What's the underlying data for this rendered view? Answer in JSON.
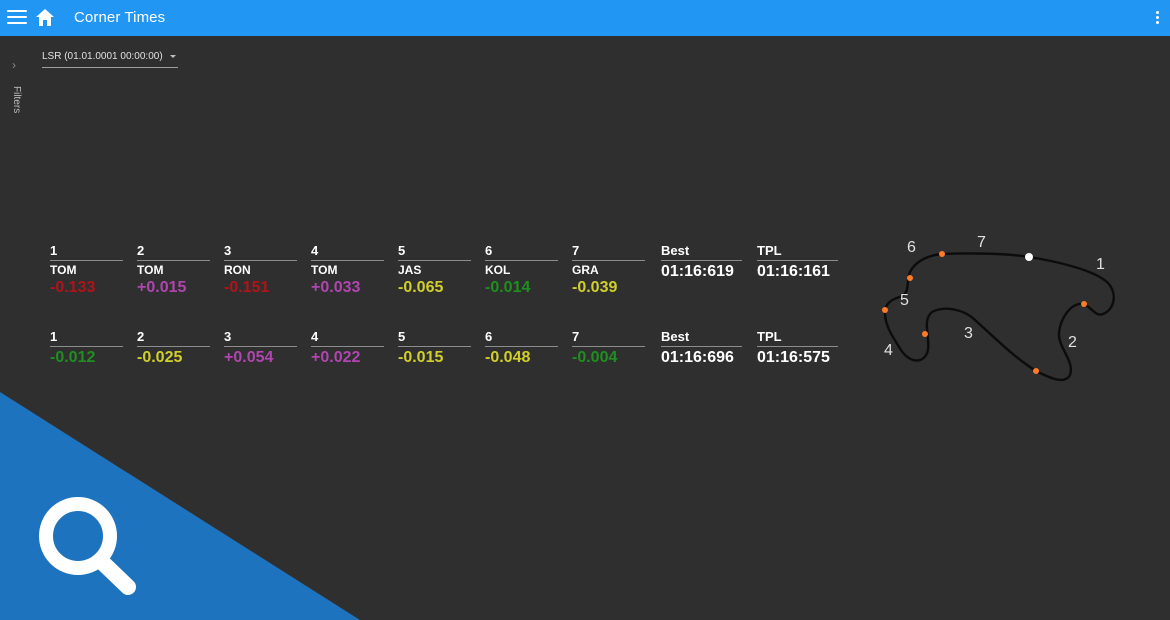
{
  "app": {
    "title": "Corner Times"
  },
  "filters": {
    "label": "Filters",
    "chevron": "›"
  },
  "session": {
    "selected": "LSR (01.01.0001 00:00:00)"
  },
  "colors": {
    "appbar": "#2196f3",
    "background": "#2f2f2f",
    "red": "#b0141a",
    "purple": "#b045b0",
    "yellow": "#d1cf2a",
    "green": "#1f8f1f",
    "track_marker": "#ff7a29",
    "overlay": "#1e73be"
  },
  "rows": [
    {
      "corners": [
        {
          "num": "1",
          "driver": "TOM",
          "delta": "-0.133",
          "color": "red"
        },
        {
          "num": "2",
          "driver": "TOM",
          "delta": "+0.015",
          "color": "purple"
        },
        {
          "num": "3",
          "driver": "RON",
          "delta": "-0.151",
          "color": "red"
        },
        {
          "num": "4",
          "driver": "TOM",
          "delta": "+0.033",
          "color": "purple"
        },
        {
          "num": "5",
          "driver": "JAS",
          "delta": "-0.065",
          "color": "yellow"
        },
        {
          "num": "6",
          "driver": "KOL",
          "delta": "-0.014",
          "color": "green"
        },
        {
          "num": "7",
          "driver": "GRA",
          "delta": "-0.039",
          "color": "yellow"
        }
      ],
      "best_label": "Best",
      "best": "01:16:619",
      "tpl_label": "TPL",
      "tpl": "01:16:161"
    },
    {
      "corners": [
        {
          "num": "1",
          "driver": "",
          "delta": "-0.012",
          "color": "green"
        },
        {
          "num": "2",
          "driver": "",
          "delta": "-0.025",
          "color": "yellow"
        },
        {
          "num": "3",
          "driver": "",
          "delta": "+0.054",
          "color": "purple"
        },
        {
          "num": "4",
          "driver": "",
          "delta": "+0.022",
          "color": "purple"
        },
        {
          "num": "5",
          "driver": "",
          "delta": "-0.015",
          "color": "yellow"
        },
        {
          "num": "6",
          "driver": "",
          "delta": "-0.048",
          "color": "yellow"
        },
        {
          "num": "7",
          "driver": "",
          "delta": "-0.004",
          "color": "green"
        }
      ],
      "best_label": "Best",
      "best": "01:16:696",
      "tpl_label": "TPL",
      "tpl": "01:16:575"
    }
  ],
  "track_map": {
    "corner_labels": [
      "1",
      "2",
      "3",
      "4",
      "5",
      "6",
      "7"
    ]
  },
  "icons": {
    "menu": "menu-icon",
    "home": "home-icon",
    "more": "more-vert-icon",
    "search": "search-icon"
  }
}
